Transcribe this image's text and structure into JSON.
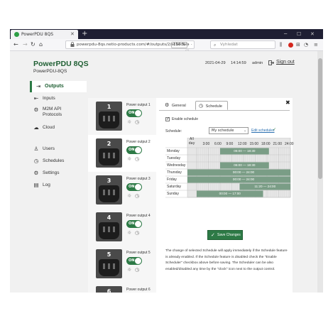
{
  "browser": {
    "tab_title": "PowerPDU 8QS",
    "url": "powerpdu-8qs.netio-products.com/#/outputs/2/schedule",
    "zoom": "110 %",
    "search_placeholder": "Vyhledat"
  },
  "header": {
    "brand": "PowerPDU 8QS",
    "model": "PowerPDU-8QS",
    "date": "2021-04-29",
    "time": "14:14:59",
    "user": "admin",
    "signout": "Sign out"
  },
  "sidebar": {
    "items": [
      {
        "label": "Outputs",
        "icon": "outputs-icon",
        "active": true
      },
      {
        "label": "Inputs",
        "icon": "inputs-icon"
      },
      {
        "label": "M2M API Protocols",
        "icon": "m2m-icon"
      },
      {
        "label": "Cloud",
        "icon": "cloud-icon"
      },
      {
        "label": "Users",
        "icon": "users-icon"
      },
      {
        "label": "Schedules",
        "icon": "schedules-icon"
      },
      {
        "label": "Settings",
        "icon": "settings-icon"
      },
      {
        "label": "Log",
        "icon": "log-icon"
      }
    ]
  },
  "outputs": [
    {
      "num": "1",
      "label": "Power output 1",
      "state": "ON"
    },
    {
      "num": "2",
      "label": "Power output 2",
      "state": "ON"
    },
    {
      "num": "3",
      "label": "Power output 3",
      "state": "ON"
    },
    {
      "num": "4",
      "label": "Power output 4",
      "state": "ON"
    },
    {
      "num": "5",
      "label": "Power output 5",
      "state": "ON"
    },
    {
      "num": "6",
      "label": "Power output 6",
      "state": "ON"
    }
  ],
  "panel": {
    "tabs": [
      "General",
      "Schedule"
    ],
    "active_tab": "Schedule",
    "enable_label": "Enable schedule",
    "enable_checked": true,
    "schedule_label": "Schedule:",
    "schedule_value": "My schedule",
    "edit_link": "Edit schedules",
    "save_label": "Save Changes",
    "note": "The change of selected Schedule will apply immediately if the Schedule feature is already enabled. If the Schedule feature is disabled check the \"Enable Scheduler\" checkbox above before saving. The Scheduler can be also enabled/disabled any time by the \"clock\" icon next to the output control."
  },
  "schedule_grid": {
    "all_day_label": "All day",
    "hours": [
      "3:00",
      "6:00",
      "9:00",
      "12:00",
      "15:00",
      "18:00",
      "21:00",
      "24:00"
    ],
    "days": [
      "Monday",
      "Tuesday",
      "Wednesday",
      "Thursday",
      "Friday",
      "Saturday",
      "Sunday"
    ],
    "blocks": [
      {
        "day": 0,
        "start": 6,
        "end": 18.5,
        "label": "06:00 — 18:30"
      },
      {
        "day": 2,
        "start": 6,
        "end": 18.5,
        "label": "06:00 — 18:30"
      },
      {
        "day": 3,
        "start": 0,
        "end": 24,
        "label": "00:00 — 24:00"
      },
      {
        "day": 4,
        "start": 0,
        "end": 24,
        "label": "00:00 — 24:00"
      },
      {
        "day": 5,
        "start": 11,
        "end": 24,
        "label": "11:20 — 24:00"
      },
      {
        "day": 6,
        "start": 0,
        "end": 17,
        "label": "00:00 — 17:00"
      }
    ],
    "all_day_rows": [
      3,
      4
    ]
  },
  "colors": {
    "accent": "#2d7a46",
    "block": "#7a9d86"
  }
}
